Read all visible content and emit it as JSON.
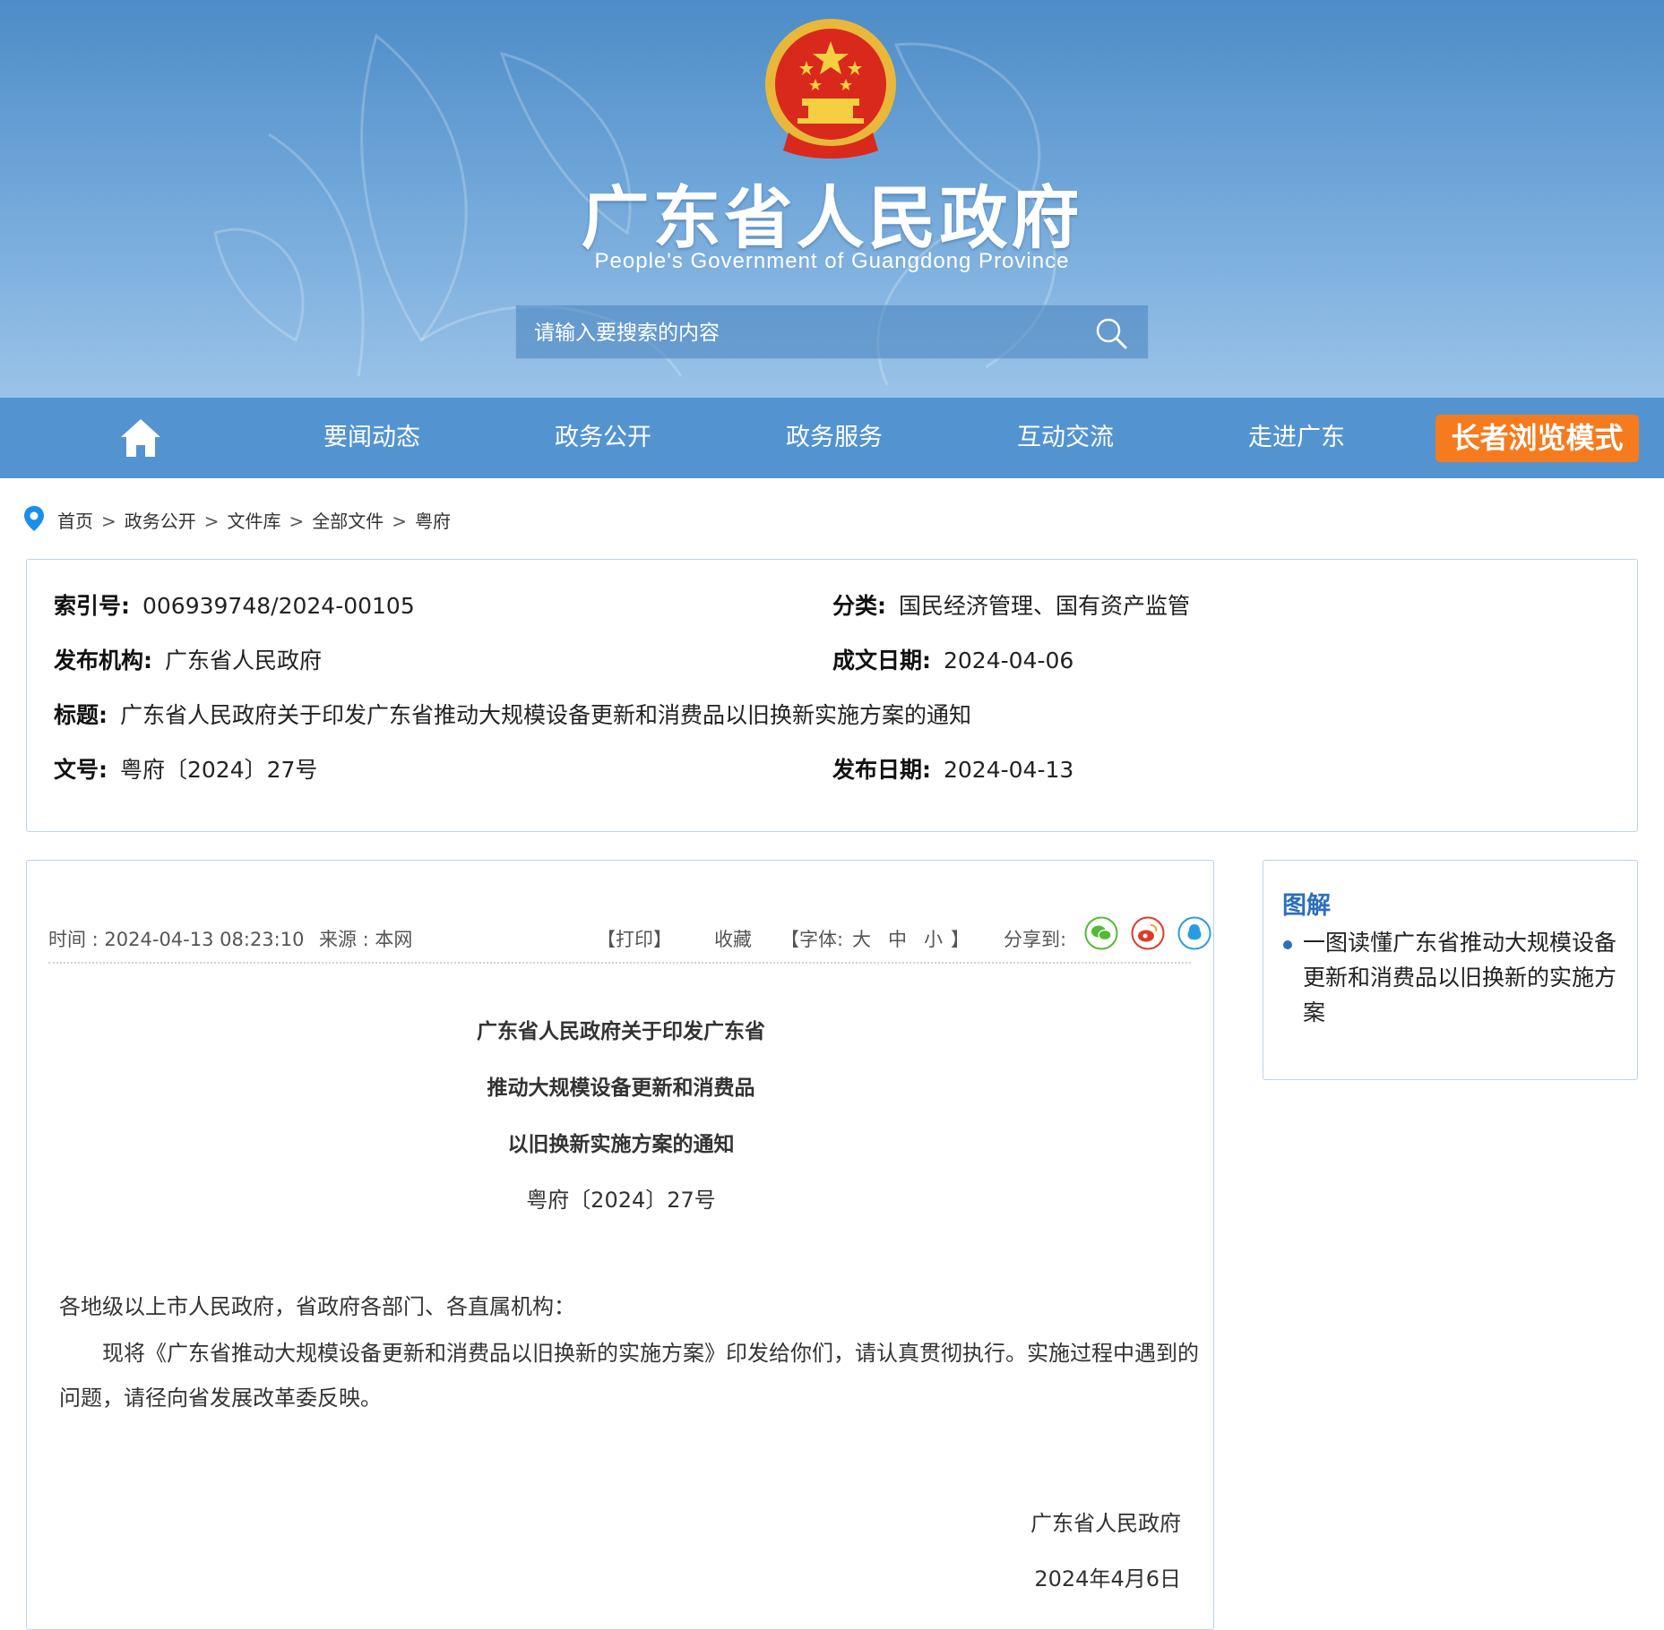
{
  "header": {
    "site_title": "广东省人民政府",
    "site_subtitle": "People's Government of Guangdong Province",
    "search_placeholder": "请输入要搜索的内容"
  },
  "nav": {
    "items": [
      "要闻动态",
      "政务公开",
      "政务服务",
      "互动交流",
      "走进广东"
    ],
    "elder_mode": "长者浏览模式"
  },
  "breadcrumb": [
    "首页",
    "政务公开",
    "文件库",
    "全部文件",
    "粤府"
  ],
  "meta": {
    "index_label": "索引号:",
    "index_value": "006939748/2024-00105",
    "category_label": "分类:",
    "category_value": "国民经济管理、国有资产监管",
    "publisher_label": "发布机构:",
    "publisher_value": "广东省人民政府",
    "written_date_label": "成文日期:",
    "written_date_value": "2024-04-06",
    "title_label": "标题:",
    "title_value": "广东省人民政府关于印发广东省推动大规模设备更新和消费品以旧换新实施方案的通知",
    "doc_no_label": "文号:",
    "doc_no_value": "粤府〔2024〕27号",
    "publish_date_label": "发布日期:",
    "publish_date_value": "2024-04-13"
  },
  "article": {
    "time": "时间 : 2024-04-13 08:23:10",
    "source": "来源 : 本网",
    "print": "【打印】",
    "favorite": "收藏",
    "font_label": "【字体:",
    "font_large": "大",
    "font_medium": "中",
    "font_small": "小",
    "font_close": "】",
    "share_label": "分享到:",
    "title_lines": [
      "广东省人民政府关于印发广东省",
      "推动大规模设备更新和消费品",
      "以旧换新实施方案的通知"
    ],
    "doc_no": "粤府〔2024〕27号",
    "salutation": "各地级以上市人民政府，省政府各部门、各直属机构：",
    "body": "现将《广东省推动大规模设备更新和消费品以旧换新的实施方案》印发给你们，请认真贯彻执行。实施过程中遇到的问题，请径向省发展改革委反映。",
    "signature": "广东省人民政府",
    "sign_date": "2024年4月6日"
  },
  "sidebar": {
    "title": "图解",
    "link": "一图读懂广东省推动大规模设备更新和消费品以旧换新的实施方案"
  },
  "colors": {
    "nav_bg": "#5394d0",
    "elder_btn": "#f57b1e",
    "accent_blue": "#2d6fbb",
    "border": "#b9d3ec"
  }
}
